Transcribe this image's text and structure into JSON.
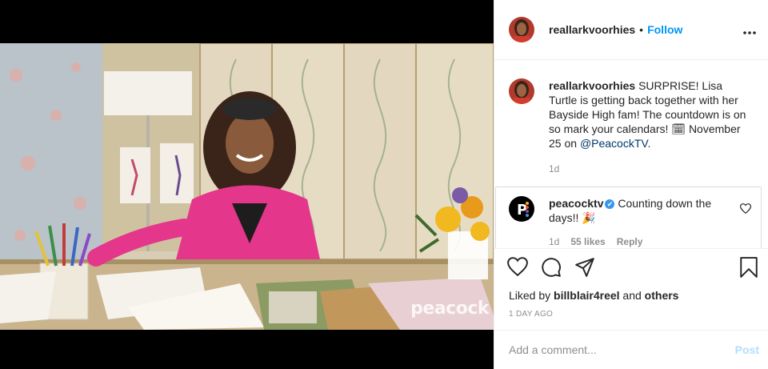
{
  "post": {
    "username": "reallarkvoorhies",
    "separator": "•",
    "follow_label": "Follow",
    "more_label": "•••",
    "media": {
      "watermark": "peacock"
    }
  },
  "caption": {
    "username": "reallarkvoorhies",
    "text": "SURPRISE! Lisa Turtle is getting back together with her Bayside High fam! The countdown is on so mark your calendars! 🗓 November 25 on ",
    "mention": "@PeacockTV",
    "tail": ".",
    "time": "1d"
  },
  "reply": {
    "username": "peacocktv",
    "verified_mark": "✔",
    "text": "Counting down the days!! 🎉",
    "time": "1d",
    "likes": "55 likes",
    "reply_label": "Reply"
  },
  "actions": {
    "icons": [
      "heart-icon",
      "comment-icon",
      "share-icon",
      "bookmark-icon"
    ],
    "liked_by_prefix": "Liked by",
    "liked_by_user": "billblair4reel",
    "liked_by_and": "and",
    "liked_by_others": "others",
    "time_ago": "1 DAY AGO"
  },
  "comment_box": {
    "placeholder": "Add a comment...",
    "post_label": "Post"
  },
  "colors": {
    "accent": "#0095f6",
    "post_disabled": "#b2dffc",
    "verified": "#3897f0"
  }
}
